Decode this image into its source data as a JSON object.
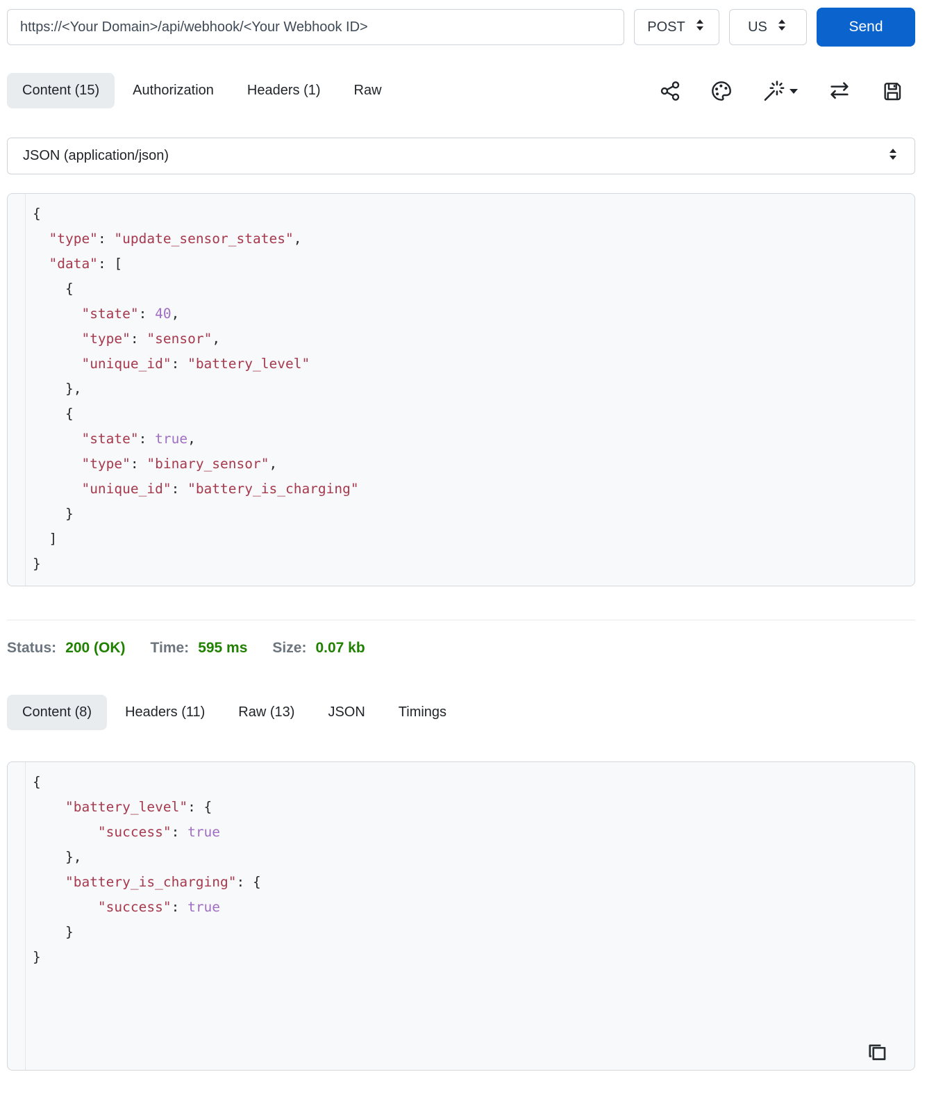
{
  "request_bar": {
    "url": "https://<Your Domain>/api/webhook/<Your Webhook ID>",
    "method": "POST",
    "region": "US",
    "send_label": "Send"
  },
  "request_tabs": [
    {
      "label": "Content (15)",
      "active": true
    },
    {
      "label": "Authorization",
      "active": false
    },
    {
      "label": "Headers (1)",
      "active": false
    },
    {
      "label": "Raw",
      "active": false
    }
  ],
  "toolbar": {
    "icons": [
      "share-icon",
      "palette-icon",
      "magic-wand-icon",
      "swap-icon",
      "save-icon"
    ]
  },
  "body_type_select": {
    "value": "JSON (application/json)"
  },
  "request_body": {
    "lines": [
      "{",
      "  \"type\": \"update_sensor_states\",",
      "  \"data\": [",
      "    {",
      "      \"state\": 40,",
      "      \"type\": \"sensor\",",
      "      \"unique_id\": \"battery_level\"",
      "    },",
      "    {",
      "      \"state\": true,",
      "      \"type\": \"binary_sensor\",",
      "      \"unique_id\": \"battery_is_charging\"",
      "    }",
      "  ]",
      "}"
    ]
  },
  "response_summary": {
    "status_label": "Status:",
    "status_value": "200 (OK)",
    "time_label": "Time:",
    "time_value": "595 ms",
    "size_label": "Size:",
    "size_value": "0.07 kb"
  },
  "response_tabs": [
    {
      "label": "Content (8)",
      "active": true
    },
    {
      "label": "Headers (11)",
      "active": false
    },
    {
      "label": "Raw (13)",
      "active": false
    },
    {
      "label": "JSON",
      "active": false
    },
    {
      "label": "Timings",
      "active": false
    }
  ],
  "response_body": {
    "lines": [
      "{",
      "    \"battery_level\": {",
      "        \"success\": true",
      "    },",
      "    \"battery_is_charging\": {",
      "        \"success\": true",
      "    }",
      "}"
    ]
  },
  "colors": {
    "accent_blue": "#0b63ce",
    "status_green": "#208000",
    "label_gray": "#6c757d",
    "code_string_red": "#a6394e",
    "code_literal_purple": "#a06fc4",
    "active_tab_bg": "#e9ecef"
  }
}
